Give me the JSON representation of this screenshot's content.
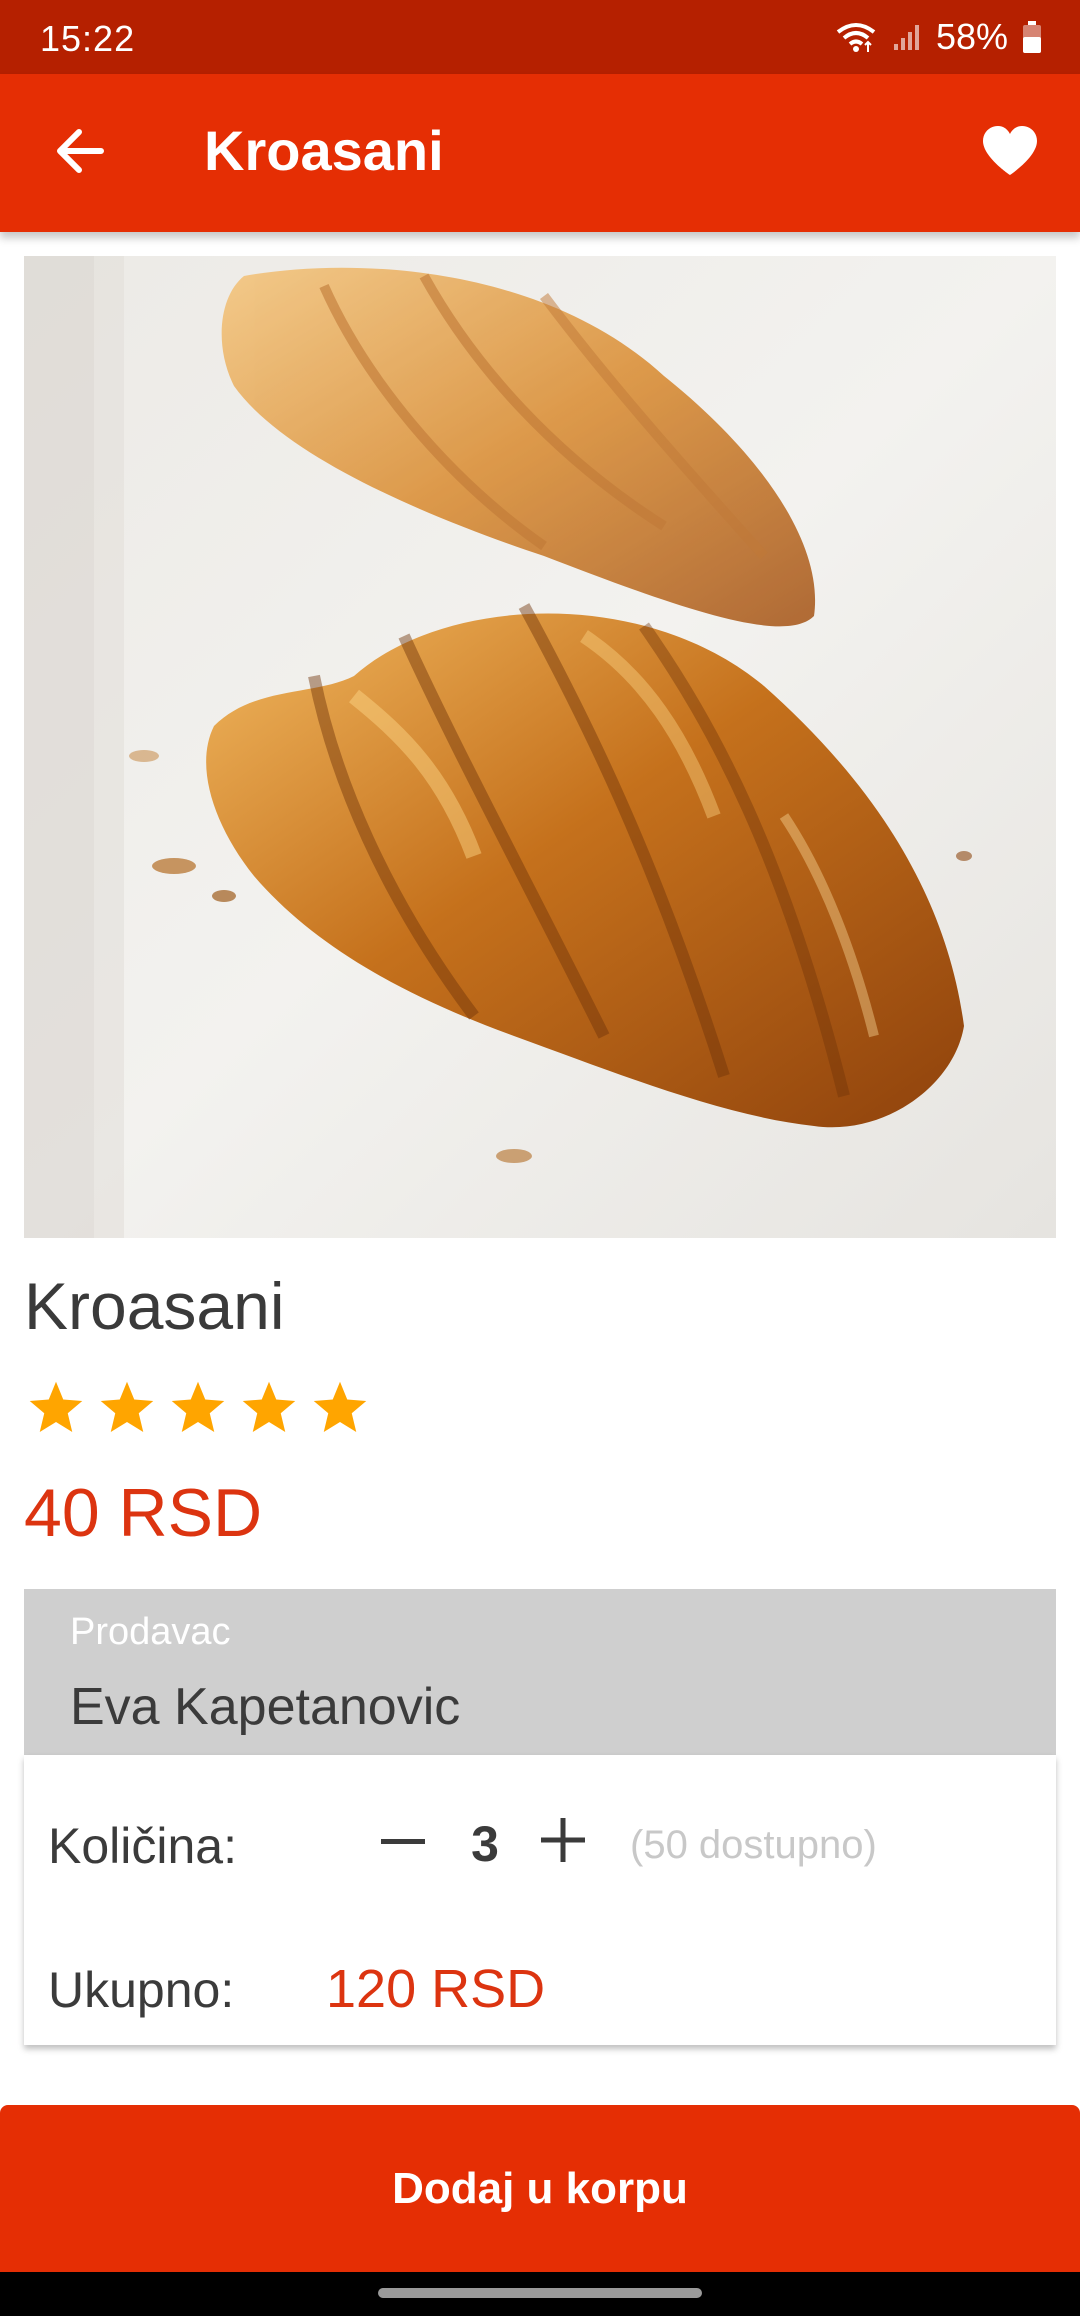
{
  "status_bar": {
    "time": "15:22",
    "battery": "58%",
    "icons": [
      "wifi-icon",
      "signal-icon",
      "battery-icon"
    ]
  },
  "app_bar": {
    "title": "Kroasani",
    "back_icon": "arrow-left-icon",
    "favorite_icon": "heart-icon"
  },
  "product": {
    "image_alt": "croissant-photo",
    "name": "Kroasani",
    "rating": 5,
    "rating_max": 5,
    "price": "40 RSD"
  },
  "seller": {
    "label": "Prodavac",
    "name": "Eva Kapetanovic"
  },
  "order": {
    "quantity_label": "Količina:",
    "quantity": "3",
    "available": "(50 dostupno)",
    "total_label": "Ukupno:",
    "total": "120 RSD"
  },
  "actions": {
    "add_to_cart": "Dodaj u korpu"
  },
  "colors": {
    "primary": "#e52e04",
    "status_bar": "#b52000",
    "price": "#dc3410",
    "star": "#ffa500",
    "seller_bg": "#cfcfcf"
  }
}
